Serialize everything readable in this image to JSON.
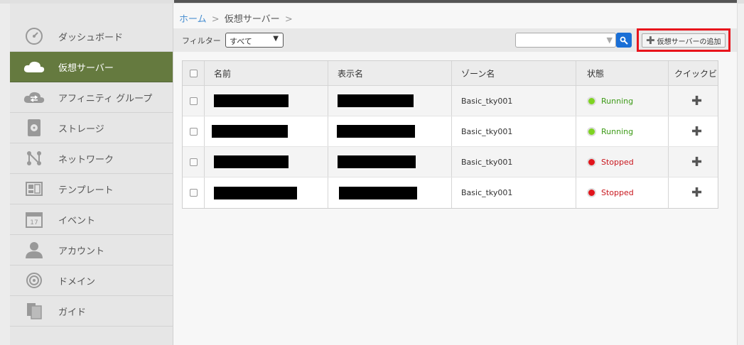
{
  "breadcrumb": {
    "home": "ホーム",
    "current": "仮想サーバー",
    "sep": ">"
  },
  "sidebar": {
    "items": [
      {
        "label": "ダッシュボード",
        "icon": "dashboard-icon"
      },
      {
        "label": "仮想サーバー",
        "icon": "cloud-icon",
        "active": true
      },
      {
        "label": "アフィニティ グループ",
        "icon": "affinity-cloud-icon"
      },
      {
        "label": "ストレージ",
        "icon": "storage-disk-icon"
      },
      {
        "label": "ネットワーク",
        "icon": "network-icon"
      },
      {
        "label": "テンプレート",
        "icon": "template-icon"
      },
      {
        "label": "イベント",
        "icon": "calendar-icon"
      },
      {
        "label": "アカウント",
        "icon": "user-icon"
      },
      {
        "label": "ドメイン",
        "icon": "domain-target-icon"
      },
      {
        "label": "ガイド",
        "icon": "guide-book-icon"
      }
    ]
  },
  "toolbar": {
    "filter_label": "フィルター",
    "filter_value": "すべて",
    "search_placeholder": "",
    "add_label": "仮想サーバーの追加"
  },
  "table": {
    "headers": [
      "名前",
      "表示名",
      "ゾーン名",
      "状態",
      "クイックビュー"
    ],
    "rows": [
      {
        "zone": "Basic_tky001",
        "status": "Running"
      },
      {
        "zone": "Basic_tky001",
        "status": "Running"
      },
      {
        "zone": "Basic_tky001",
        "status": "Stopped"
      },
      {
        "zone": "Basic_tky001",
        "status": "Stopped"
      }
    ]
  },
  "colors": {
    "active_nav": "#657a3f",
    "running": "#3d9a17",
    "stopped": "#c9161d",
    "highlight_border": "#e8141c",
    "search_button": "#1a6fd6"
  }
}
